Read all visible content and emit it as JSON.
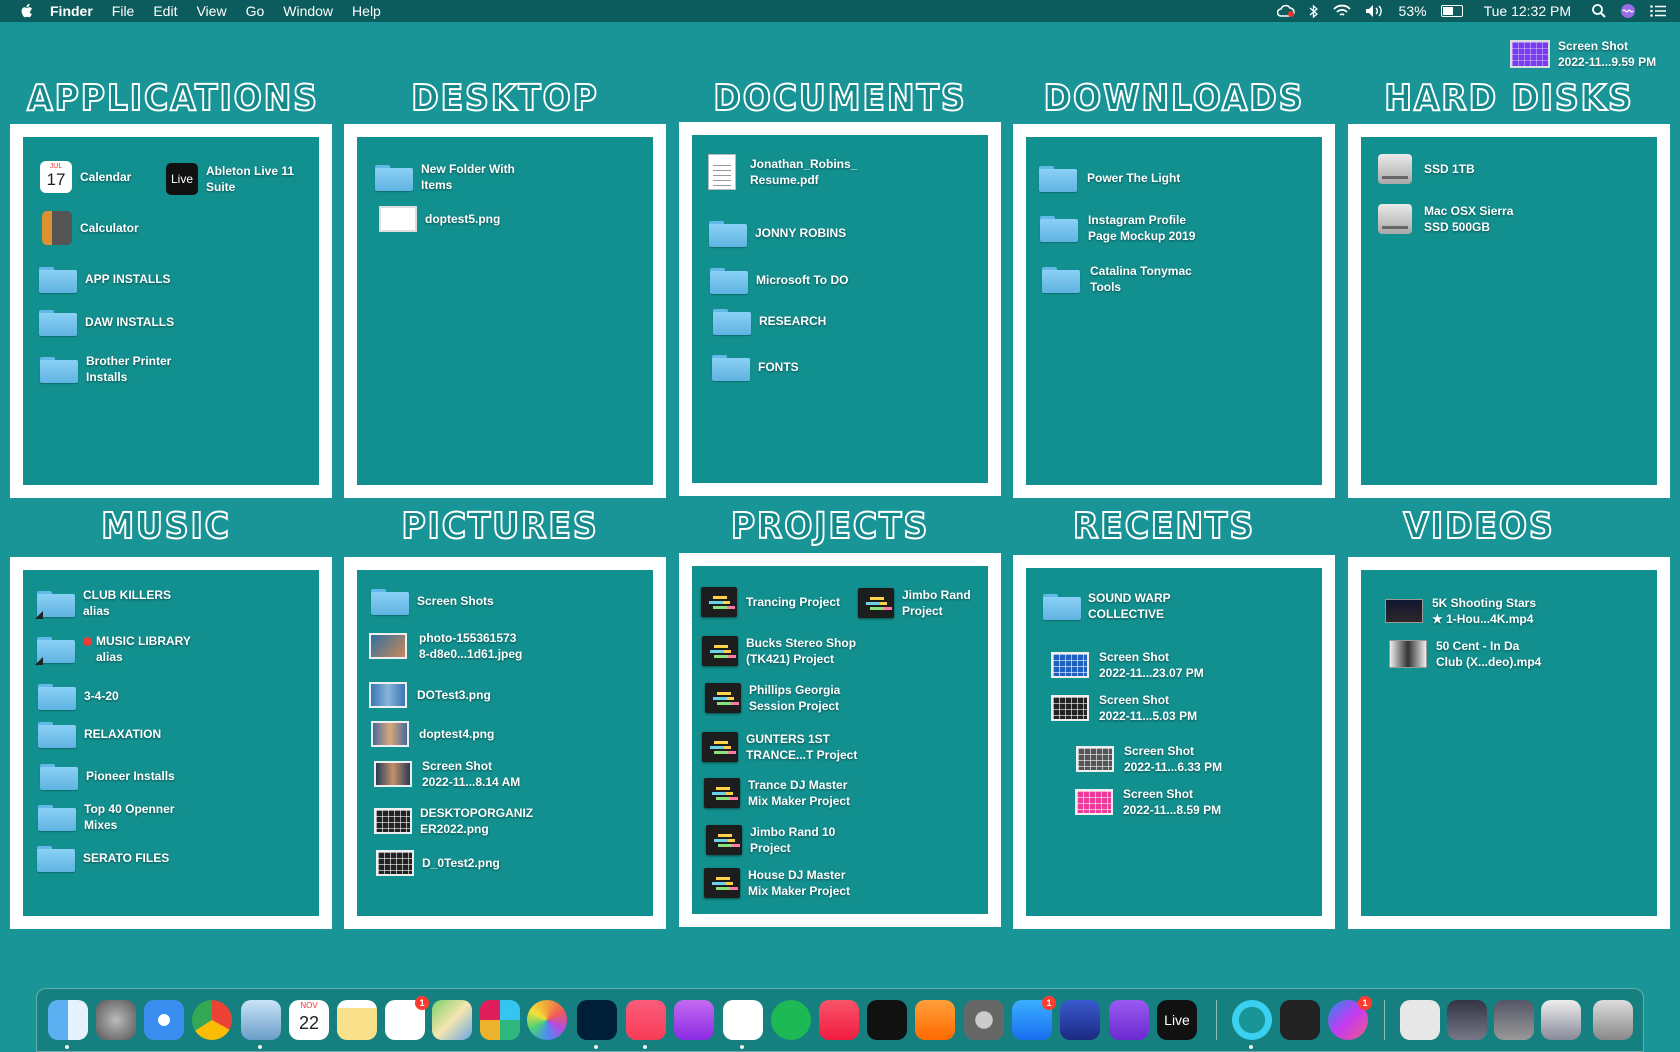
{
  "menubar": {
    "app_name": "Finder",
    "menus": [
      "File",
      "Edit",
      "View",
      "Go",
      "Window",
      "Help"
    ],
    "battery": "53%",
    "clock": "Tue 12:32 PM"
  },
  "desktop_file": {
    "label": "Screen Shot\n2022-11...9.59 PM"
  },
  "sections": {
    "applications": {
      "title": "APPLICATIONS",
      "items": [
        {
          "label": "Calendar",
          "icon": "calendar-app-icon"
        },
        {
          "label": "Ableton Live 11\nSuite",
          "icon": "ableton-live-icon"
        },
        {
          "label": "Calculator",
          "icon": "calculator-app-icon"
        },
        {
          "label": "APP INSTALLS",
          "icon": "folder-icon"
        },
        {
          "label": "DAW INSTALLS",
          "icon": "folder-icon"
        },
        {
          "label": "Brother Printer\nInstalls",
          "icon": "folder-icon"
        }
      ],
      "calendar_day": "17",
      "live_text": "Live"
    },
    "desktop": {
      "title": "DESKTOP",
      "items": [
        {
          "label": "New Folder With\nItems",
          "icon": "folder-icon"
        },
        {
          "label": "doptest5.png",
          "icon": "image-file-icon"
        }
      ]
    },
    "documents": {
      "title": "DOCUMENTS",
      "items": [
        {
          "label": "Jonathan_Robins_\nResume.pdf",
          "icon": "pdf-document-icon"
        },
        {
          "label": "JONNY ROBINS",
          "icon": "folder-icon"
        },
        {
          "label": "Microsoft To DO",
          "icon": "folder-icon"
        },
        {
          "label": "RESEARCH",
          "icon": "folder-icon"
        },
        {
          "label": "FONTS",
          "icon": "folder-icon"
        }
      ]
    },
    "downloads": {
      "title": "DOWNLOADS",
      "items": [
        {
          "label": "Power The Light",
          "icon": "folder-icon"
        },
        {
          "label": "Instagram Profile\nPage Mockup 2019",
          "icon": "folder-icon"
        },
        {
          "label": "Catalina Tonymac\nTools",
          "icon": "folder-icon"
        }
      ]
    },
    "hard_disks": {
      "title": "HARD DISKS",
      "items": [
        {
          "label": "SSD 1TB",
          "icon": "hard-disk-icon"
        },
        {
          "label": "Mac OSX Sierra\nSSD 500GB",
          "icon": "hard-disk-icon"
        }
      ]
    },
    "music": {
      "title": "MUSIC",
      "items": [
        {
          "label": "CLUB KILLERS\nalias",
          "icon": "folder-alias-icon"
        },
        {
          "label": "MUSIC LIBRARY\nalias",
          "icon": "folder-alias-icon",
          "tag": "red"
        },
        {
          "label": "3-4-20",
          "icon": "folder-icon"
        },
        {
          "label": "RELAXATION",
          "icon": "folder-icon"
        },
        {
          "label": "Pioneer Installs",
          "icon": "folder-icon"
        },
        {
          "label": "Top 40 Openner\nMixes",
          "icon": "folder-icon"
        },
        {
          "label": "SERATO FILES",
          "icon": "folder-icon"
        }
      ]
    },
    "pictures": {
      "title": "PICTURES",
      "items": [
        {
          "label": "Screen Shots",
          "icon": "folder-icon"
        },
        {
          "label": "photo-155361573\n8-d8e0...1d61.jpeg",
          "icon": "image-file-icon"
        },
        {
          "label": "DOTest3.png",
          "icon": "image-file-icon"
        },
        {
          "label": "doptest4.png",
          "icon": "image-file-icon"
        },
        {
          "label": "Screen Shot\n2022-11...8.14 AM",
          "icon": "image-file-icon"
        },
        {
          "label": "DESKTOPORGANIZ\nER2022.png",
          "icon": "image-file-icon"
        },
        {
          "label": "D_0Test2.png",
          "icon": "image-file-icon"
        }
      ]
    },
    "projects": {
      "title": "PROJECTS",
      "items": [
        {
          "label": "Trancing Project",
          "icon": "ableton-project-icon"
        },
        {
          "label": "Jimbo Rand\nProject",
          "icon": "ableton-project-icon"
        },
        {
          "label": "Bucks Stereo Shop\n(TK421) Project",
          "icon": "ableton-project-icon"
        },
        {
          "label": "Phillips Georgia\nSession Project",
          "icon": "ableton-project-icon"
        },
        {
          "label": "GUNTERS 1ST\nTRANCE...T Project",
          "icon": "ableton-project-icon"
        },
        {
          "label": "Trance DJ Master\nMix Maker Project",
          "icon": "ableton-project-icon"
        },
        {
          "label": "Jimbo Rand 10\nProject",
          "icon": "ableton-project-icon"
        },
        {
          "label": "House DJ Master\nMix Maker Project",
          "icon": "ableton-project-icon"
        }
      ]
    },
    "recents": {
      "title": "RECENTS",
      "items": [
        {
          "label": "SOUND WARP\nCOLLECTIVE",
          "icon": "folder-icon"
        },
        {
          "label": "Screen Shot\n2022-11...23.07 PM",
          "icon": "image-file-icon"
        },
        {
          "label": "Screen Shot\n2022-11...5.03 PM",
          "icon": "image-file-icon"
        },
        {
          "label": "Screen Shot\n2022-11...6.33 PM",
          "icon": "image-file-icon"
        },
        {
          "label": "Screen Shot\n2022-11...8.59 PM",
          "icon": "image-file-icon"
        }
      ]
    },
    "videos": {
      "title": "VIDEOS",
      "items": [
        {
          "label": "5K Shooting Stars\n★ 1-Hou...4K.mp4",
          "icon": "video-file-icon"
        },
        {
          "label": "50 Cent - In Da\nClub (X...deo).mp4",
          "icon": "video-file-icon"
        }
      ]
    }
  },
  "dock": {
    "calendar_month": "NOV",
    "calendar_day": "22",
    "live_label": "Live",
    "badge_value": "1",
    "apps": [
      "finder-icon",
      "launchpad-icon",
      "safari-icon",
      "chrome-icon",
      "preview-icon",
      "calendar-icon",
      "notes-icon",
      "reminders-icon",
      "maps-icon",
      "slack-icon",
      "photos-icon",
      "photoshop-icon",
      "music-icon",
      "podcasts-icon",
      "podcaster-icon",
      "spotify-icon",
      "news-icon",
      "apple-tv-icon",
      "books-icon",
      "system-preferences-icon",
      "app-store-icon",
      "audio-app-icon",
      "shortcut-app-icon",
      "ableton-live-icon",
      "alexa-icon",
      "terminal-icon",
      "messenger-icon",
      "document-icon",
      "window-stack-icon",
      "window-stack-icon",
      "window-stack-icon",
      "trash-icon"
    ]
  }
}
